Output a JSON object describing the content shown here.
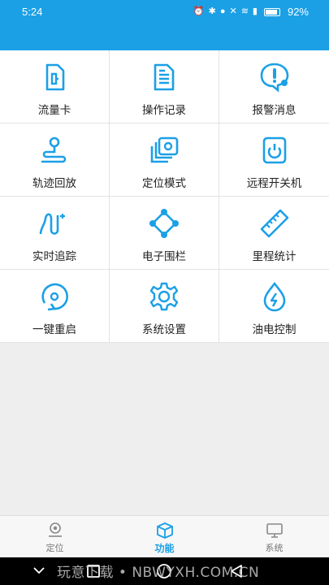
{
  "status_bar": {
    "time": "5:24",
    "battery": "92%"
  },
  "menu": [
    {
      "label": "流量卡",
      "icon": "sim-card-icon"
    },
    {
      "label": "操作记录",
      "icon": "document-icon"
    },
    {
      "label": "报警消息",
      "icon": "alarm-message-icon"
    },
    {
      "label": "轨迹回放",
      "icon": "track-replay-icon"
    },
    {
      "label": "定位模式",
      "icon": "location-mode-icon"
    },
    {
      "label": "远程开关机",
      "icon": "power-icon"
    },
    {
      "label": "实时追踪",
      "icon": "realtime-tracking-icon"
    },
    {
      "label": "电子围栏",
      "icon": "geofence-icon"
    },
    {
      "label": "里程统计",
      "icon": "ruler-icon"
    },
    {
      "label": "一键重启",
      "icon": "restart-icon"
    },
    {
      "label": "系统设置",
      "icon": "gear-icon"
    },
    {
      "label": "油电控制",
      "icon": "fuel-power-icon"
    }
  ],
  "tabs": [
    {
      "label": "定位",
      "icon": "location-pin-icon",
      "active": false
    },
    {
      "label": "功能",
      "icon": "cube-icon",
      "active": true
    },
    {
      "label": "系统",
      "icon": "monitor-icon",
      "active": false
    }
  ],
  "watermark": "玩意下载 • NBWYXH.COM.CN",
  "colors": {
    "accent": "#1ba0e6",
    "background": "#eeeeee"
  }
}
